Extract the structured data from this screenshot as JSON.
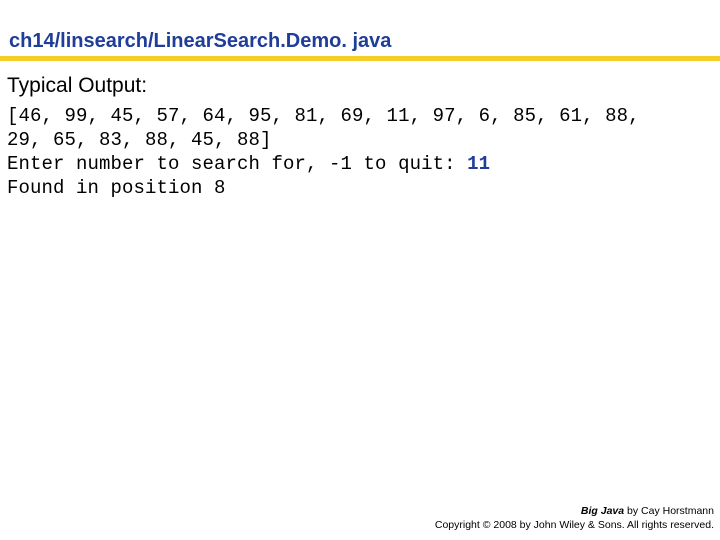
{
  "slide": {
    "title": "ch14/linsearch/LinearSearch.Demo. java",
    "accent_rule_color": "#F5CE23",
    "title_color": "#1F3D99"
  },
  "content": {
    "heading": "Typical Output:",
    "console_lines": [
      {
        "text": "[46, 99, 45, 57, 64, 95, 81, 69, 11, 97, 6, 85, 61, 88,"
      },
      {
        "text": "29, 65, 83, 88, 45, 88]"
      },
      {
        "prompt": "Enter number to search for, -1 to quit: ",
        "input": "11"
      },
      {
        "text": "Found in position 8"
      }
    ]
  },
  "footer": {
    "book_title": "Big Java",
    "byline": " by Cay Horstmann",
    "copyright": "Copyright © 2008 by John Wiley & Sons.  All rights reserved."
  }
}
